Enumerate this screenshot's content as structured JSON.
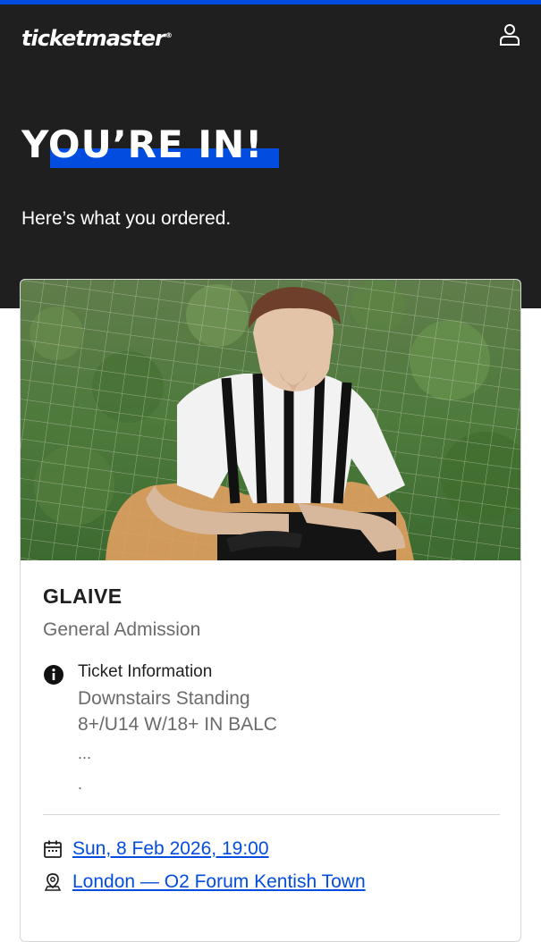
{
  "header": {
    "logo_text": "ticketmaster",
    "logo_mark": "®",
    "account_icon": "person-icon"
  },
  "hero": {
    "headline": "YOU’RE IN!",
    "subline": "Here’s what you ordered."
  },
  "order": {
    "event_name": "GLAIVE",
    "ticket_type": "General Admission",
    "info_icon": "info-icon",
    "info_title": "Ticket Information",
    "info_lines": [
      "Downstairs Standing",
      "8+/U14 W/18+ IN BALC",
      "...",
      "."
    ],
    "date_icon": "calendar-icon",
    "date_text": "Sun, 8 Feb 2026, 19:00",
    "venue_icon": "location-pin-icon",
    "venue_text": "London — O2 Forum Kentish Town"
  },
  "colors": {
    "brand_blue": "#024ddf",
    "hero_bg": "#1f1f1f",
    "text_dark": "#1f1f1f",
    "text_muted": "#6b6b6b"
  }
}
